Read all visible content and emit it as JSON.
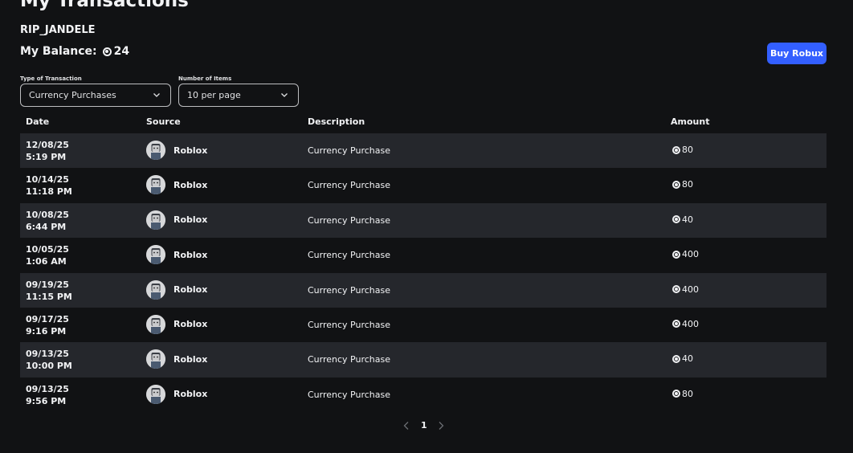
{
  "header": {
    "title": "My Transactions",
    "username": "RIP_JANDELE",
    "balance_label": "My Balance:",
    "balance_value": "24",
    "buy_button": "Buy Robux"
  },
  "filters": {
    "type_label": "Type of Transaction",
    "type_value": "Currency Purchases",
    "count_label": "Number of Items",
    "count_value": "10 per page"
  },
  "table": {
    "columns": [
      "Date",
      "Source",
      "Description",
      "Amount"
    ],
    "rows": [
      {
        "date": "12/08/25",
        "time": "5:19 PM",
        "source": "Roblox",
        "description": "Currency Purchase",
        "amount": "80"
      },
      {
        "date": "10/14/25",
        "time": "11:18 PM",
        "source": "Roblox",
        "description": "Currency Purchase",
        "amount": "80"
      },
      {
        "date": "10/08/25",
        "time": "6:44 PM",
        "source": "Roblox",
        "description": "Currency Purchase",
        "amount": "40"
      },
      {
        "date": "10/05/25",
        "time": "1:06 AM",
        "source": "Roblox",
        "description": "Currency Purchase",
        "amount": "400"
      },
      {
        "date": "09/19/25",
        "time": "11:15 PM",
        "source": "Roblox",
        "description": "Currency Purchase",
        "amount": "400"
      },
      {
        "date": "09/17/25",
        "time": "9:16 PM",
        "source": "Roblox",
        "description": "Currency Purchase",
        "amount": "400"
      },
      {
        "date": "09/13/25",
        "time": "10:00 PM",
        "source": "Roblox",
        "description": "Currency Purchase",
        "amount": "40"
      },
      {
        "date": "09/13/25",
        "time": "9:56 PM",
        "source": "Roblox",
        "description": "Currency Purchase",
        "amount": "80"
      }
    ]
  },
  "pagination": {
    "current_page": "1"
  },
  "colors": {
    "background": "#111214",
    "row_alt": "#25272c",
    "accent": "#335fff",
    "text": "#f2f3f5"
  },
  "icons": {
    "currency": "robux-icon",
    "dropdown": "chevron-down-icon",
    "prev": "chevron-left-icon",
    "next": "chevron-right-icon",
    "source_avatar": "avatar"
  }
}
